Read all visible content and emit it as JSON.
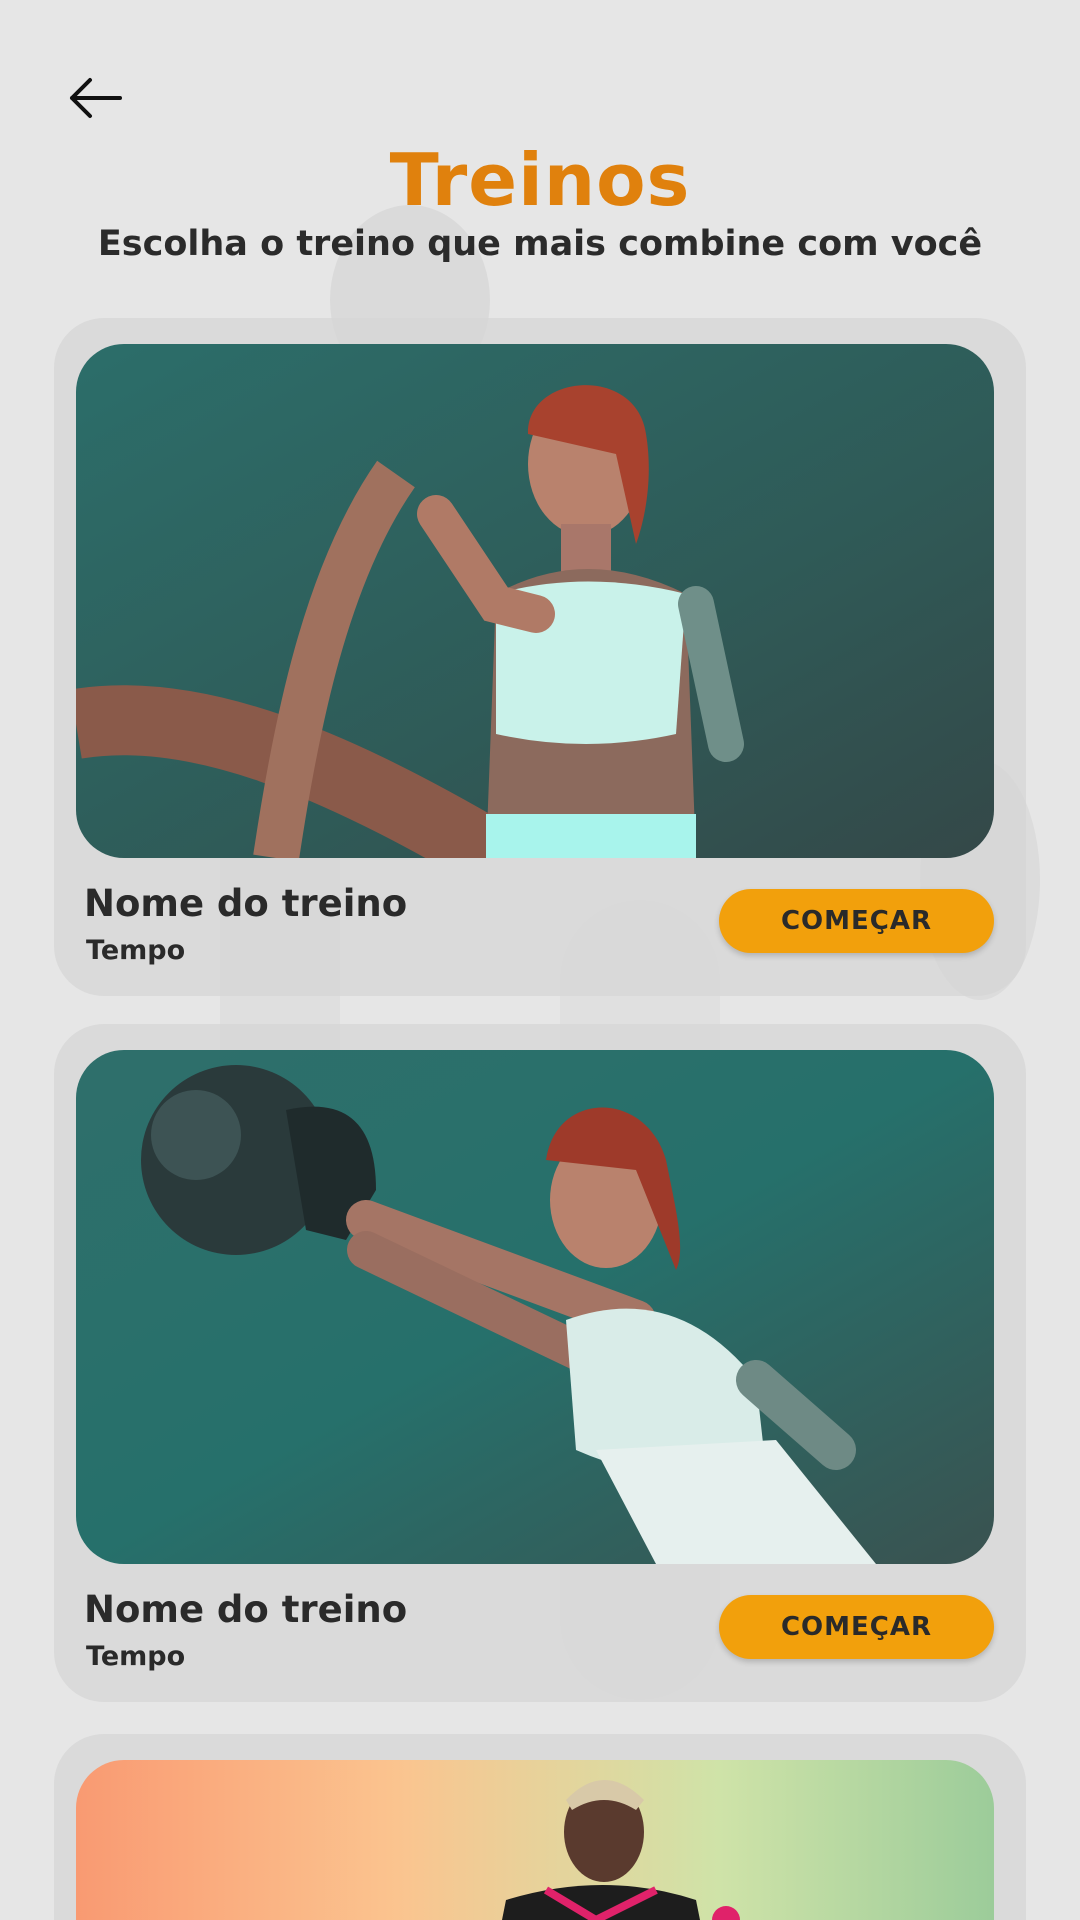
{
  "header": {
    "back_icon": "arrow-left-icon",
    "title": "Treinos",
    "subtitle": "Escolha o treino que mais combine com você"
  },
  "colors": {
    "accent": "#e0810d",
    "button": "#f2a00c",
    "background": "#e6e6e6"
  },
  "workouts": [
    {
      "name": "Nome do treino",
      "time": "Tempo",
      "button_label": "COMEÇAR",
      "image": "woman-battle-ropes-photo"
    },
    {
      "name": "Nome do treino",
      "time": "Tempo",
      "button_label": "COMEÇAR",
      "image": "woman-kettlebell-photo"
    },
    {
      "image": "woman-gradient-background-photo"
    }
  ]
}
